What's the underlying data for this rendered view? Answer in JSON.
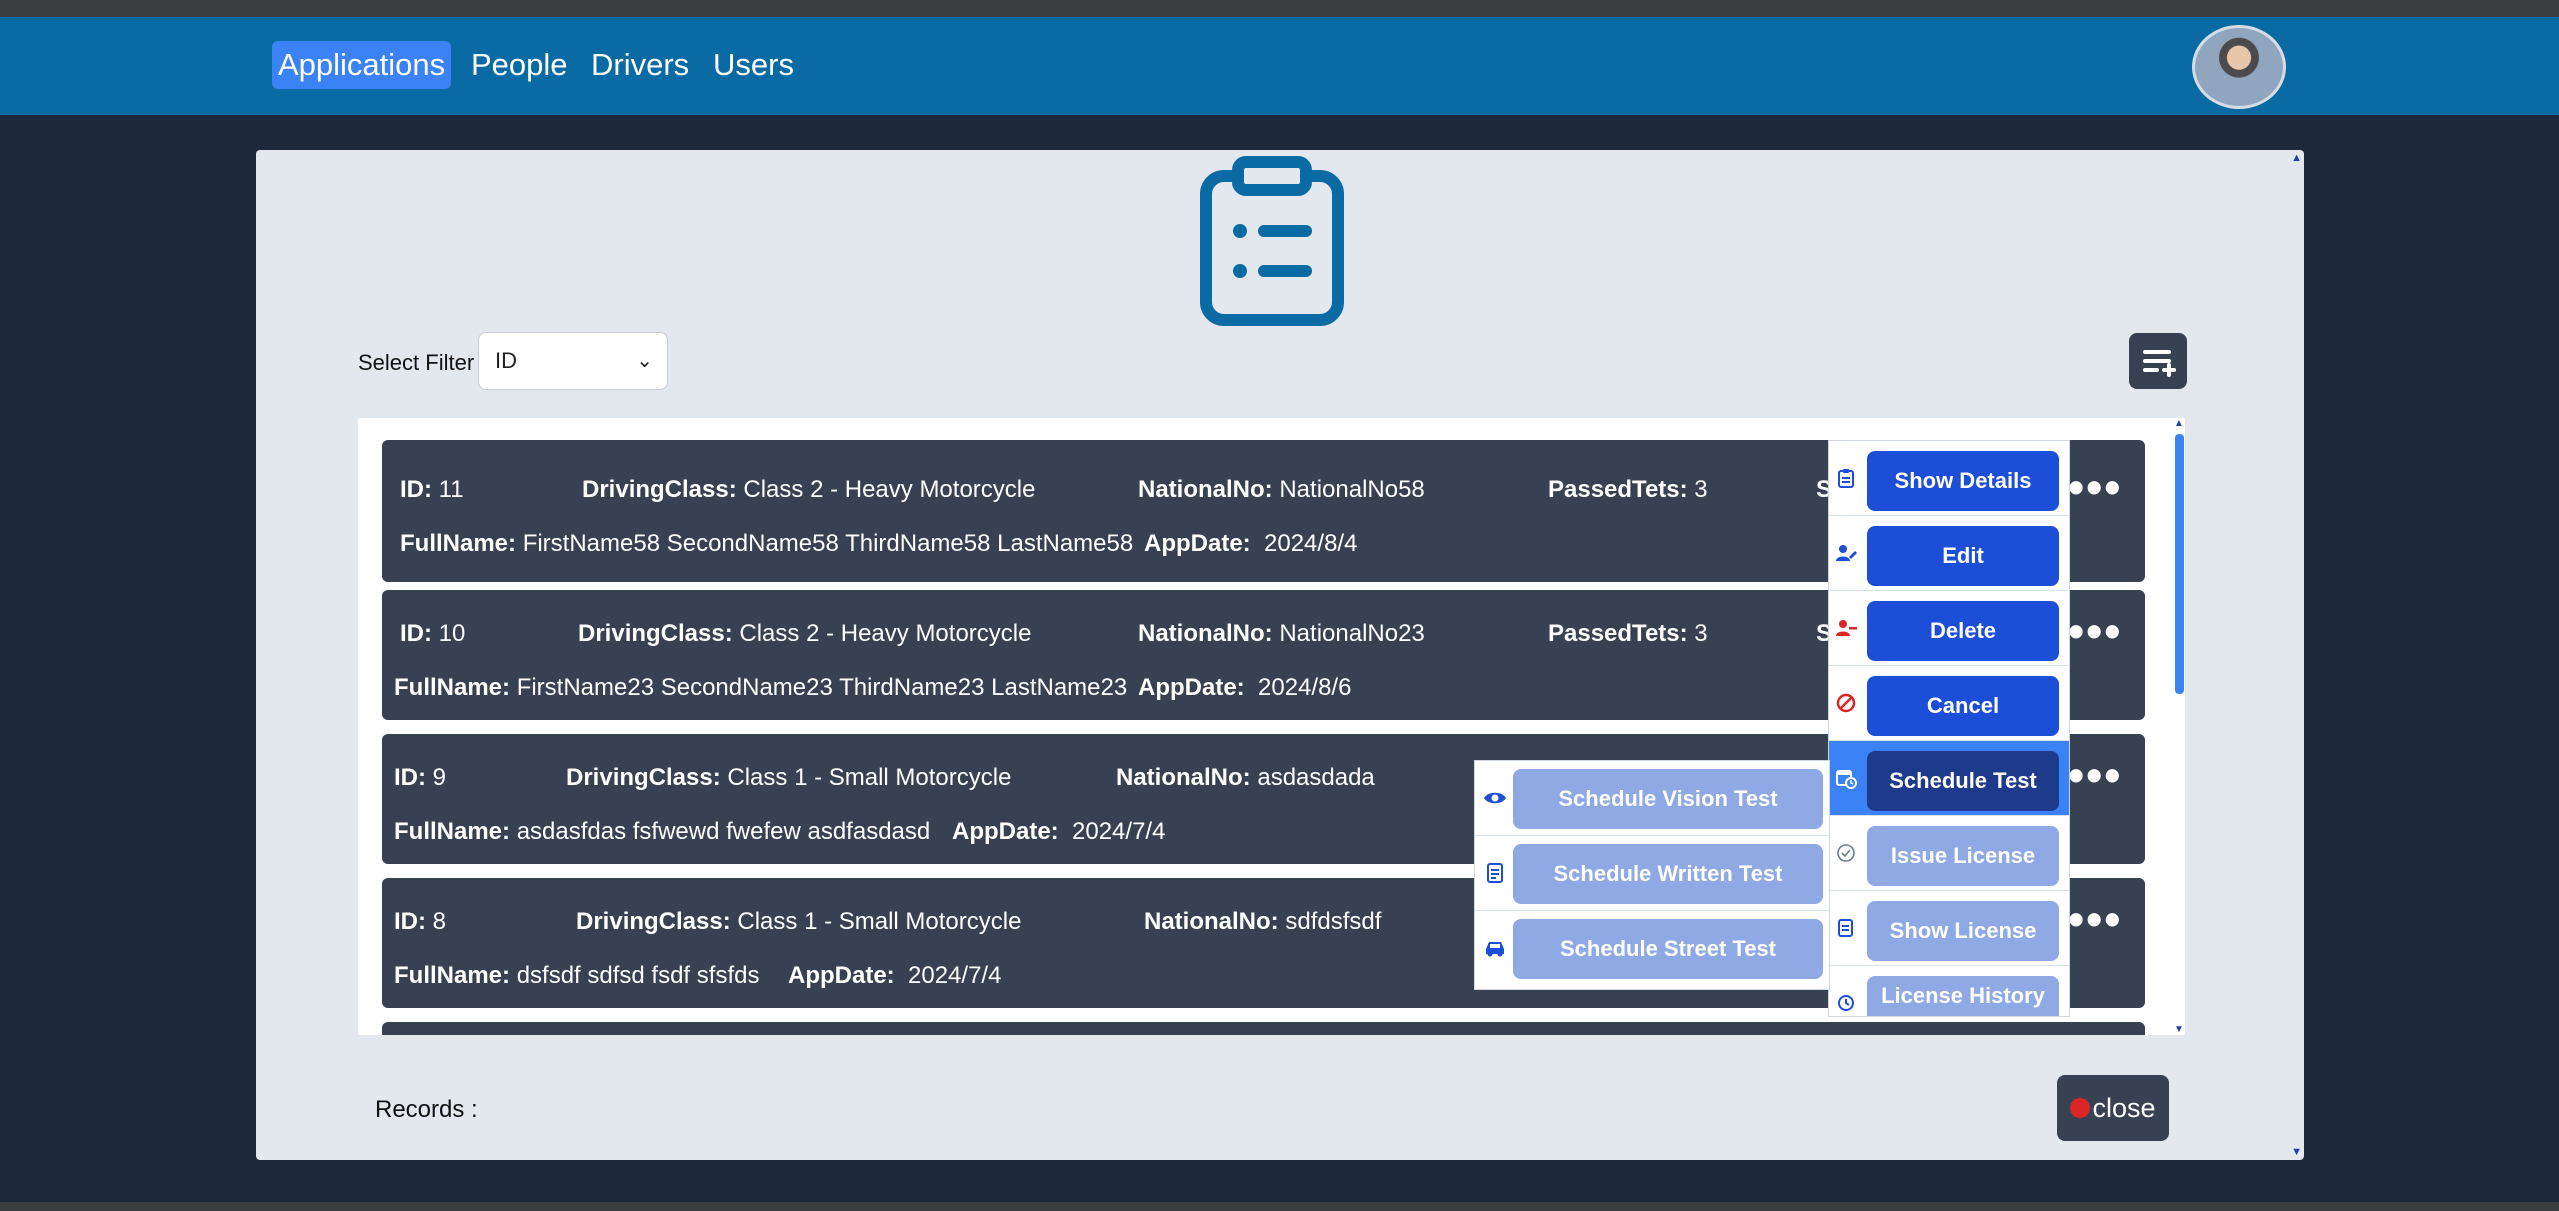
{
  "nav": {
    "items": [
      {
        "label": "Applications",
        "active": true
      },
      {
        "label": "People",
        "active": false
      },
      {
        "label": "Drivers",
        "active": false
      },
      {
        "label": "Users",
        "active": false
      }
    ]
  },
  "filter": {
    "label": "Select Filter",
    "selected": "ID"
  },
  "applications": [
    {
      "id_label": "ID:",
      "id": "11",
      "class_label": "DrivingClass:",
      "class": "Class 2 - Heavy Motorcycle",
      "nat_label": "NationalNo:",
      "nat": "NationalNo58",
      "passed_label": "PassedTets:",
      "passed": "3",
      "name_label": "FullName:",
      "name": "FirstName58 SecondName58 ThirdName58 LastName58",
      "date_label": "AppDate:",
      "date": "2024/8/4"
    },
    {
      "id_label": "ID:",
      "id": "10",
      "class_label": "DrivingClass:",
      "class": "Class 2 - Heavy Motorcycle",
      "nat_label": "NationalNo:",
      "nat": "NationalNo23",
      "passed_label": "PassedTets:",
      "passed": "3",
      "name_label": "FullName:",
      "name": "FirstName23 SecondName23 ThirdName23 LastName23",
      "date_label": "AppDate:",
      "date": "2024/8/6"
    },
    {
      "id_label": "ID:",
      "id": "9",
      "class_label": "DrivingClass:",
      "class": "Class 1 - Small Motorcycle",
      "nat_label": "NationalNo:",
      "nat": "asdasdada",
      "name_label": "FullName:",
      "name": "asdasfdas fsfwewd fwefew asdfasdasd",
      "date_label": "AppDate:",
      "date": "2024/7/4"
    },
    {
      "id_label": "ID:",
      "id": "8",
      "class_label": "DrivingClass:",
      "class": "Class 1 - Small Motorcycle",
      "nat_label": "NationalNo:",
      "nat": "sdfdsfsdf",
      "name_label": "FullName:",
      "name": "dsfsdf sdfsd fsdf sfsfds",
      "date_label": "AppDate:",
      "date": "2024/7/4"
    }
  ],
  "clipped_fragment": "S",
  "more_glyph": "•••",
  "actions_menu": [
    {
      "label": "Show Details",
      "icon": "clipboard-icon"
    },
    {
      "label": "Edit",
      "icon": "user-edit-icon"
    },
    {
      "label": "Delete",
      "icon": "user-minus-icon"
    },
    {
      "label": "Cancel",
      "icon": "ban-icon"
    },
    {
      "label": "Schedule Test",
      "icon": "calendar-clock-icon",
      "selected": true
    },
    {
      "label": "Issue License",
      "icon": "check-circle-icon"
    },
    {
      "label": "Show License",
      "icon": "license-icon"
    },
    {
      "label": "License History",
      "icon": "history-icon"
    }
  ],
  "test_submenu": [
    {
      "label": "Schedule Vision Test",
      "icon": "eye-icon"
    },
    {
      "label": "Schedule Written Test",
      "icon": "document-icon"
    },
    {
      "label": "Schedule Street Test",
      "icon": "car-icon"
    }
  ],
  "records_label": "Records :",
  "close_label": "close",
  "colors": {
    "navbar": "#0a6aa3",
    "primary": "#1d4ed8",
    "card": "#374151",
    "panel": "#e3e8ef"
  }
}
